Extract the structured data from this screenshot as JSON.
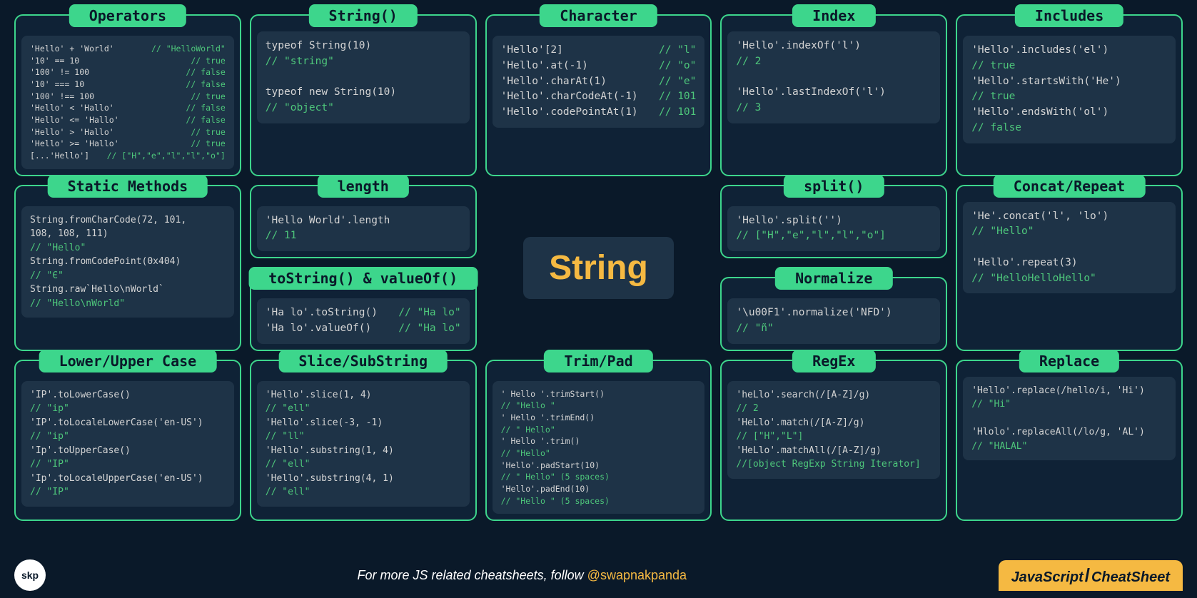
{
  "center": "String",
  "footer": {
    "text": "For more JS related cheatsheets, follow ",
    "handle": "@swapnakpanda",
    "brand_left": "JavaScript",
    "brand_right": "CheatSheet",
    "logo": "skp"
  },
  "cards": {
    "operators": {
      "title": "Operators",
      "lines": [
        [
          "'Hello' + 'World'",
          "// \"HelloWorld\""
        ],
        [
          "'10' == 10",
          "// true"
        ],
        [
          "'100' != 100",
          "// false"
        ],
        [
          "'10' === 10",
          "// false"
        ],
        [
          "'100' !== 100",
          "// true"
        ],
        [
          "'Hello' < 'Hallo'",
          "// false"
        ],
        [
          "'Hello' <= 'Hallo'",
          "// false"
        ],
        [
          "'Hello' > 'Hallo'",
          "// true"
        ],
        [
          "'Hello' >= 'Hallo'",
          "// true"
        ],
        [
          "[...'Hello']",
          "// [\"H\",\"e\",\"l\",\"l\",\"o\"]"
        ]
      ]
    },
    "string": {
      "title": "String()",
      "body": [
        [
          "typeof String(10)",
          null
        ],
        [
          null,
          "// \"string\""
        ],
        [
          "",
          null
        ],
        [
          "typeof new String(10)",
          null
        ],
        [
          null,
          "// \"object\""
        ]
      ]
    },
    "character": {
      "title": "Character",
      "lines": [
        [
          "'Hello'[2]",
          "// \"l\""
        ],
        [
          "'Hello'.at(-1)",
          "// \"o\""
        ],
        [
          "'Hello'.charAt(1)",
          "// \"e\""
        ],
        [
          "'Hello'.charCodeAt(-1)",
          "// 101"
        ],
        [
          "'Hello'.codePointAt(1)",
          "// 101"
        ]
      ]
    },
    "index": {
      "title": "Index",
      "body": [
        [
          "'Hello'.indexOf('l')",
          null
        ],
        [
          null,
          "// 2"
        ],
        [
          "",
          null
        ],
        [
          "'Hello'.lastIndexOf('l')",
          null
        ],
        [
          null,
          "// 3"
        ]
      ]
    },
    "includes": {
      "title": "Includes",
      "body": [
        [
          "'Hello'.includes('el')",
          null
        ],
        [
          null,
          "// true"
        ],
        [
          "'Hello'.startsWith('He')",
          null
        ],
        [
          null,
          "// true"
        ],
        [
          "'Hello'.endsWith('ol')",
          null
        ],
        [
          null,
          "// false"
        ]
      ]
    },
    "static": {
      "title": "Static Methods",
      "body": [
        [
          "String.fromCharCode(72, 101,",
          null
        ],
        [
          "               108, 108, 111)",
          null
        ],
        [
          null,
          "// \"Hello\""
        ],
        [
          "String.fromCodePoint(0x404)",
          null
        ],
        [
          null,
          "// \"Є\""
        ],
        [
          "String.raw`Hello\\nWorld`",
          null
        ],
        [
          null,
          "// \"Hello\\nWorld\""
        ]
      ]
    },
    "length": {
      "title": "length",
      "body": [
        [
          "'Hello World'.length",
          null
        ],
        [
          null,
          "// 11"
        ]
      ]
    },
    "tostring": {
      "title": "toString() & valueOf()",
      "lines": [
        [
          "'Ha lo'.toString()",
          "// \"Ha lo\""
        ],
        [
          "'Ha lo'.valueOf()",
          "// \"Ha lo\""
        ]
      ]
    },
    "split": {
      "title": "split()",
      "body": [
        [
          "'Hello'.split('')",
          null
        ],
        [
          null,
          "// [\"H\",\"e\",\"l\",\"l\",\"o\"]"
        ]
      ]
    },
    "normalize": {
      "title": "Normalize",
      "body": [
        [
          "'\\u00F1'.normalize('NFD')",
          null
        ],
        [
          null,
          "// \"ñ\""
        ]
      ]
    },
    "concat": {
      "title": "Concat/Repeat",
      "body": [
        [
          "'He'.concat('l', 'lo')",
          null
        ],
        [
          null,
          "// \"Hello\""
        ],
        [
          "",
          null
        ],
        [
          "'Hello'.repeat(3)",
          null
        ],
        [
          null,
          "// \"HelloHelloHello\""
        ]
      ]
    },
    "case": {
      "title": "Lower/Upper Case",
      "body": [
        [
          "'IP'.toLowerCase()",
          null
        ],
        [
          null,
          "// \"ip\""
        ],
        [
          "'IP'.toLocaleLowerCase('en-US')",
          null
        ],
        [
          null,
          "// \"ip\""
        ],
        [
          "'Ip'.toUpperCase()",
          null
        ],
        [
          null,
          "// \"IP\""
        ],
        [
          "'Ip'.toLocaleUpperCase('en-US')",
          null
        ],
        [
          null,
          "// \"IP\""
        ]
      ]
    },
    "slice": {
      "title": "Slice/SubString",
      "body": [
        [
          "'Hello'.slice(1, 4)",
          null
        ],
        [
          null,
          "// \"ell\""
        ],
        [
          "'Hello'.slice(-3, -1)",
          null
        ],
        [
          null,
          "// \"ll\""
        ],
        [
          "'Hello'.substring(1, 4)",
          null
        ],
        [
          null,
          "// \"ell\""
        ],
        [
          "'Hello'.substring(4, 1)",
          null
        ],
        [
          null,
          "// \"ell\""
        ]
      ]
    },
    "trim": {
      "title": "Trim/Pad",
      "body": [
        [
          "'  Hello  '.trimStart()",
          null
        ],
        [
          null,
          "// \"Hello  \""
        ],
        [
          "'  Hello  '.trimEnd()",
          null
        ],
        [
          null,
          "// \"  Hello\""
        ],
        [
          "'  Hello  '.trim()",
          null
        ],
        [
          null,
          "// \"Hello\""
        ],
        [
          "'Hello'.padStart(10)",
          null
        ],
        [
          null,
          "// \"     Hello\" (5 spaces)"
        ],
        [
          "'Hello'.padEnd(10)",
          null
        ],
        [
          null,
          "// \"Hello     \" (5 spaces)"
        ]
      ]
    },
    "regex": {
      "title": "RegEx",
      "body": [
        [
          "'heLlo'.search(/[A-Z]/g)",
          null
        ],
        [
          null,
          "// 2"
        ],
        [
          "'HeLlo'.match(/[A-Z]/g)",
          null
        ],
        [
          null,
          "// [\"H\",\"L\"]"
        ],
        [
          "'HeLlo'.matchAll(/[A-Z]/g)",
          null
        ],
        [
          null,
          "//[object RegExp String Iterator]"
        ]
      ]
    },
    "replace": {
      "title": "Replace",
      "body": [
        [
          "'Hello'.replace(/hello/i, 'Hi')",
          null
        ],
        [
          null,
          "// \"Hi\""
        ],
        [
          "",
          null
        ],
        [
          "'Hlolo'.replaceAll(/lo/g, 'AL')",
          null
        ],
        [
          null,
          "// \"HALAL\""
        ]
      ]
    }
  }
}
